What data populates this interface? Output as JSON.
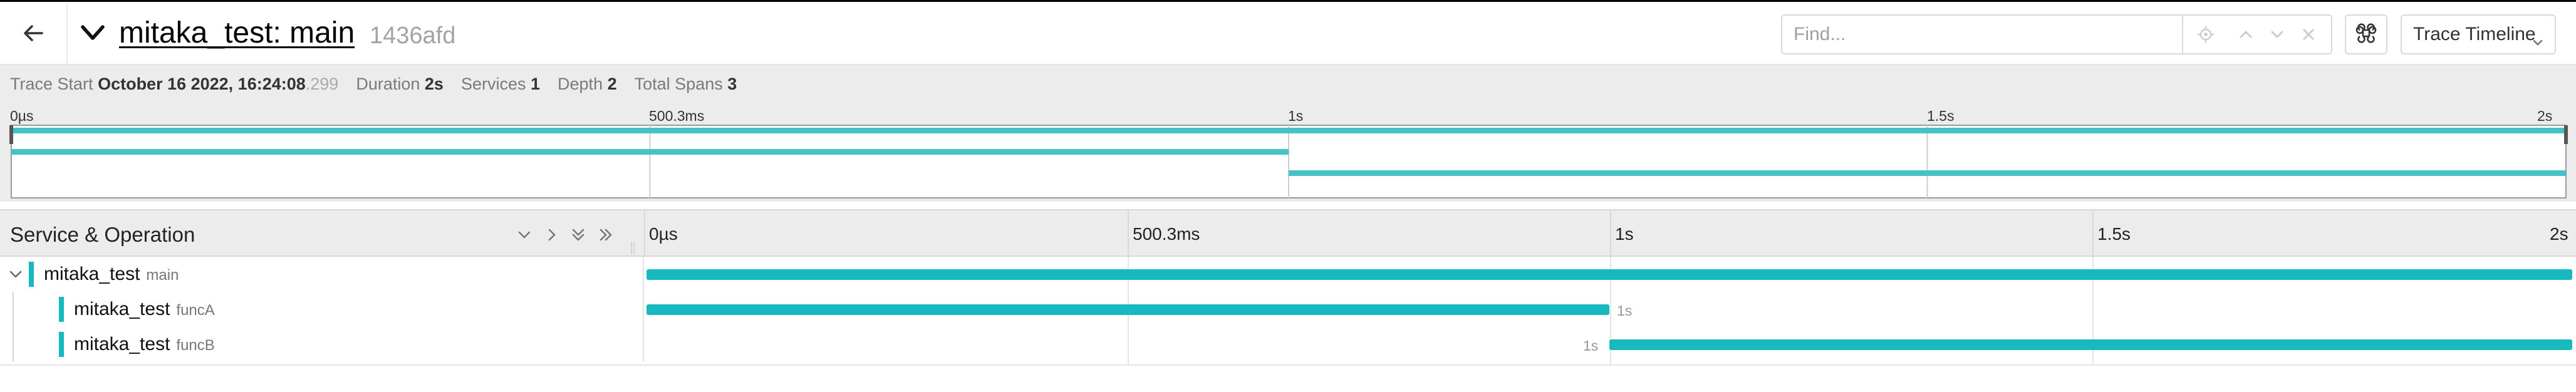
{
  "header": {
    "title": "mitaka_test: main",
    "trace_id": "1436afd",
    "find_placeholder": "Find...",
    "keyboard_shortcut_icon": "command-icon",
    "view_select": "Trace Timeline"
  },
  "meta": {
    "trace_start_label": "Trace Start",
    "trace_start_value": "October 16 2022, 16:24:08",
    "trace_start_ms": ".299",
    "duration_label": "Duration",
    "duration_value": "2s",
    "services_label": "Services",
    "services_value": "1",
    "depth_label": "Depth",
    "depth_value": "2",
    "total_spans_label": "Total Spans",
    "total_spans_value": "3"
  },
  "ticks": [
    "0µs",
    "500.3ms",
    "1s",
    "1.5s",
    "2s"
  ],
  "timeline": {
    "column_title": "Service & Operation",
    "total_duration_s": 2.0
  },
  "spans": [
    {
      "service": "mitaka_test",
      "operation": "main",
      "start_s": 0.0,
      "duration_s": 2.0,
      "duration_label": "",
      "depth": 0,
      "expandable": true
    },
    {
      "service": "mitaka_test",
      "operation": "funcA",
      "start_s": 0.0,
      "duration_s": 1.0,
      "duration_label": "1s",
      "label_side": "right",
      "depth": 1,
      "expandable": false
    },
    {
      "service": "mitaka_test",
      "operation": "funcB",
      "start_s": 1.0,
      "duration_s": 1.0,
      "duration_label": "1s",
      "label_side": "left",
      "depth": 1,
      "expandable": false
    }
  ],
  "colors": {
    "service": "#17b8be",
    "minimap_span": "#45c2c6"
  }
}
